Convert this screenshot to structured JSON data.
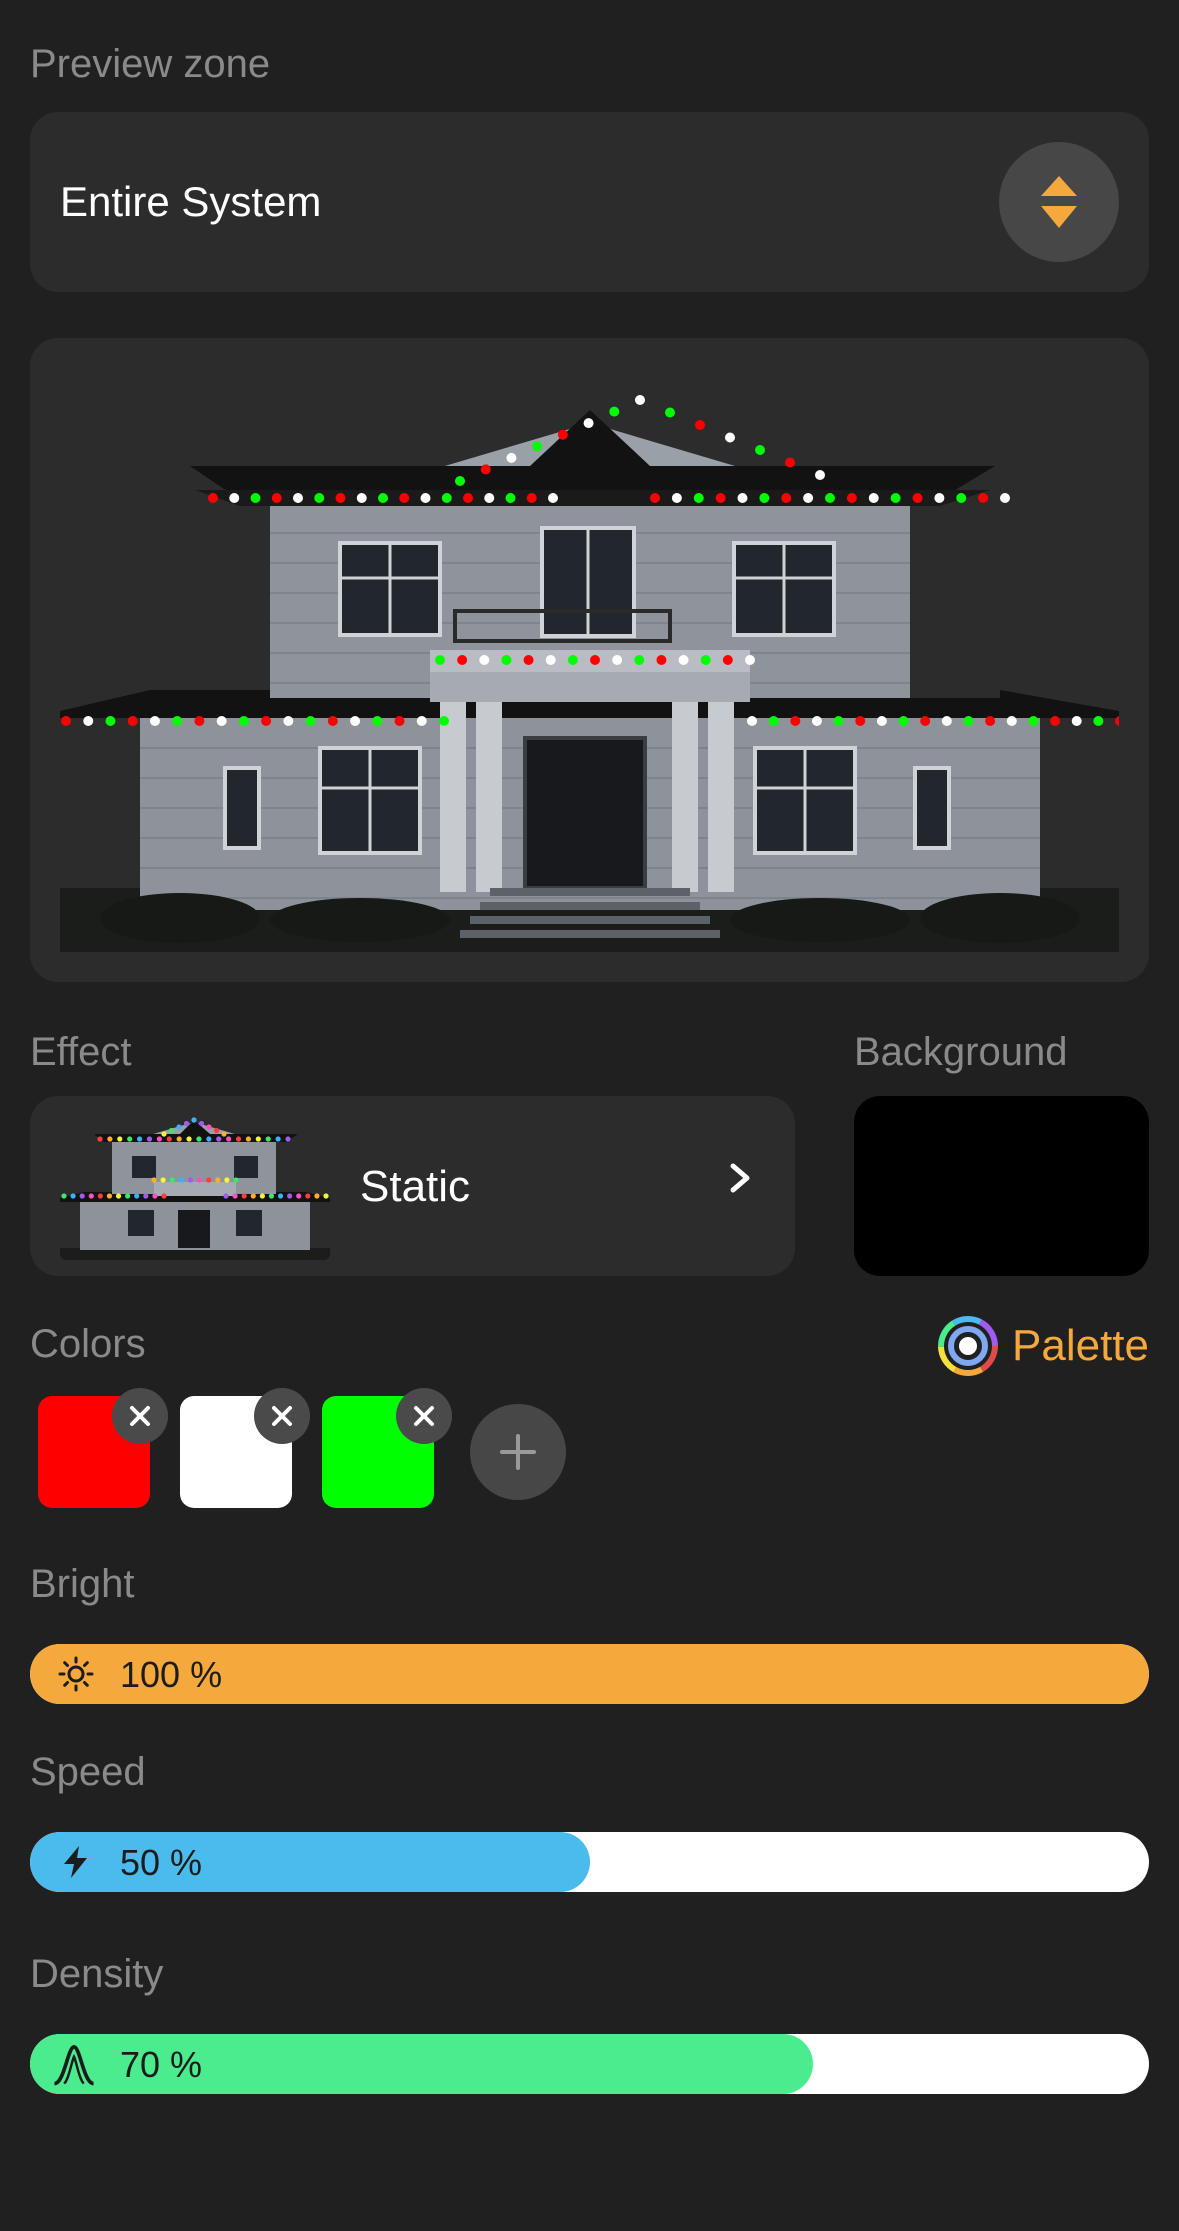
{
  "zone": {
    "label": "Preview zone",
    "value": "Entire System"
  },
  "effect": {
    "label": "Effect",
    "name": "Static"
  },
  "background": {
    "label": "Background",
    "color": "#000000"
  },
  "colors": {
    "label": "Colors",
    "palette_label": "Palette",
    "items": [
      "#ff0000",
      "#ffffff",
      "#00ff00"
    ]
  },
  "bright": {
    "label": "Bright",
    "display": "100 %",
    "percent": 100,
    "color": "#f5a83b",
    "icon": "sun-icon"
  },
  "speed": {
    "label": "Speed",
    "display": "50 %",
    "percent": 50,
    "color": "#4bbbed",
    "icon": "lightning-icon"
  },
  "density": {
    "label": "Density",
    "display": "70 %",
    "percent": 70,
    "color": "#4aec8d",
    "icon": "wave-peak-icon"
  },
  "accent_color": "#f5a83b"
}
